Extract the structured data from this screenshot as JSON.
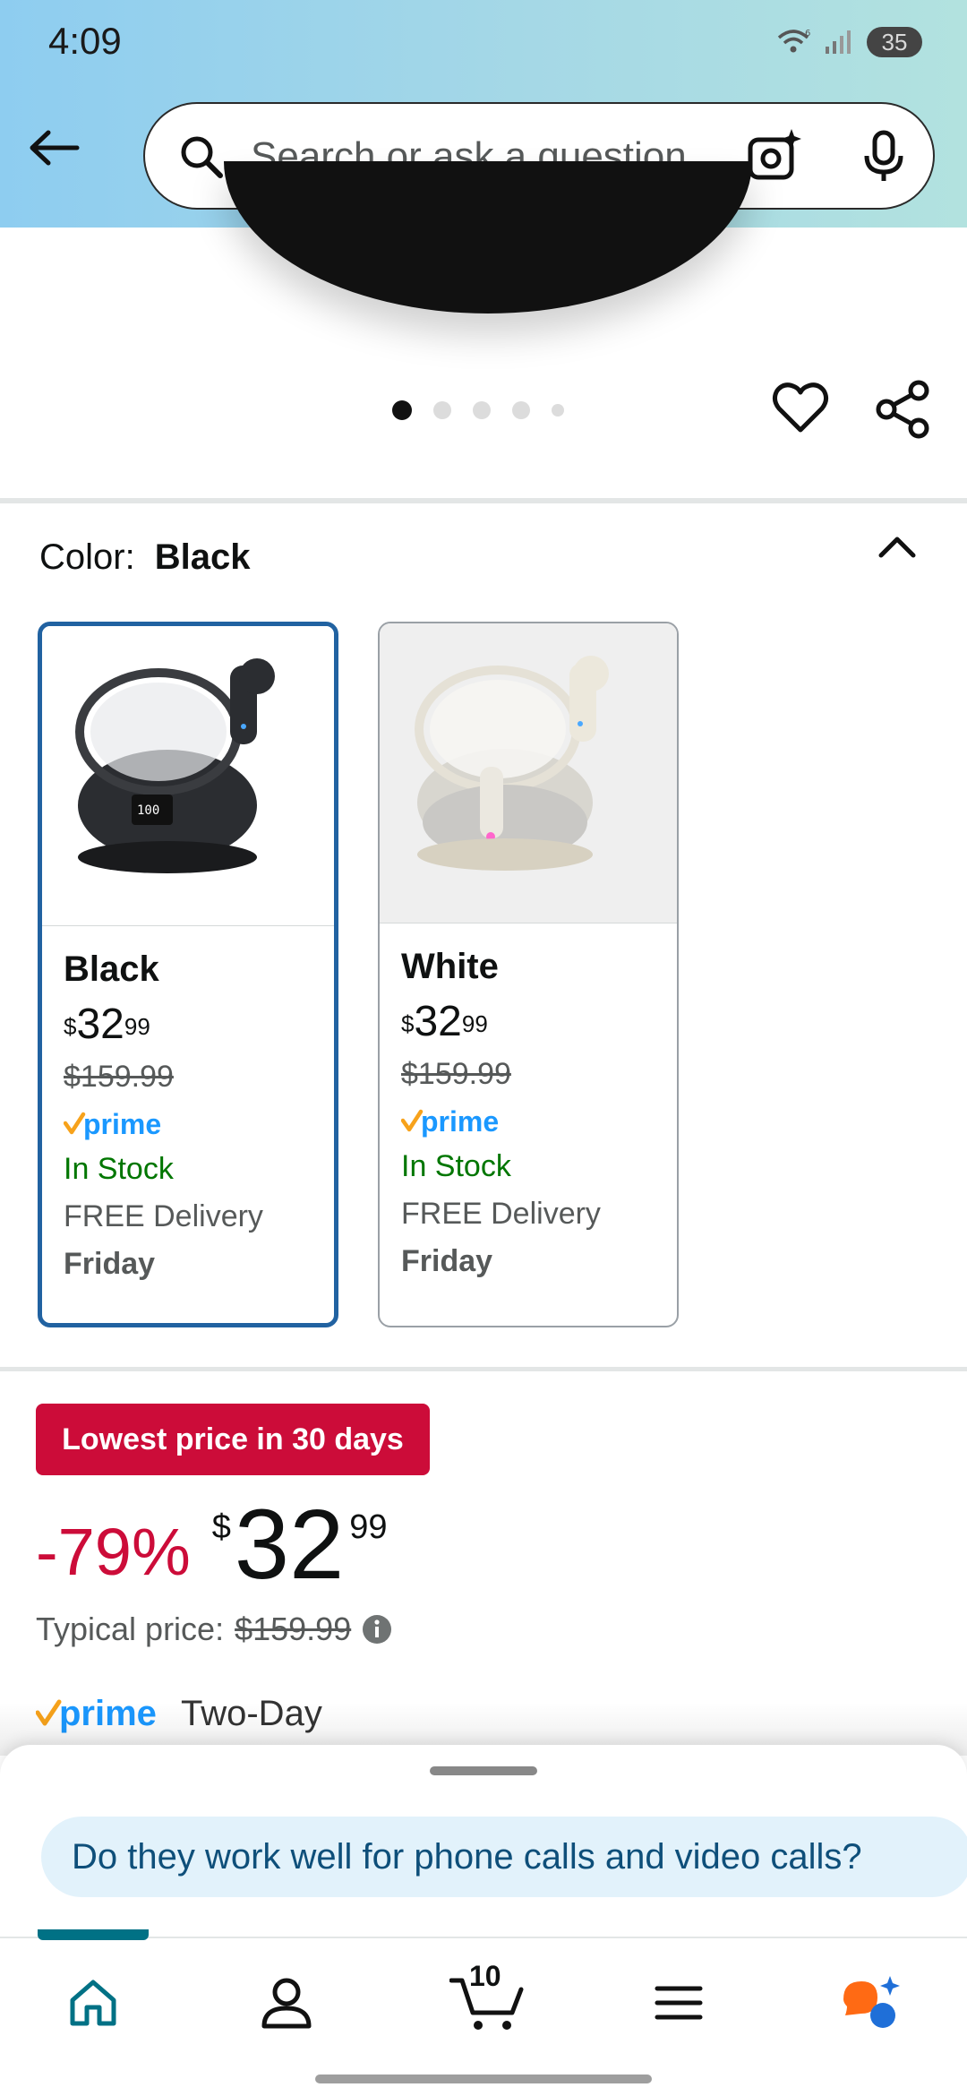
{
  "status_bar": {
    "time": "4:09",
    "battery": "35"
  },
  "search": {
    "placeholder": "Search or ask a question"
  },
  "color_selector": {
    "label": "Color:",
    "selected": "Black",
    "options": [
      {
        "name": "Black",
        "price_whole": "32",
        "price_fraction": "99",
        "currency": "$",
        "list_price": "$159.99",
        "prime": "prime",
        "stock": "In Stock",
        "delivery": "FREE Delivery",
        "delivery_day": "Friday"
      },
      {
        "name": "White",
        "price_whole": "32",
        "price_fraction": "99",
        "currency": "$",
        "list_price": "$159.99",
        "prime": "prime",
        "stock": "In Stock",
        "delivery": "FREE Delivery",
        "delivery_day": "Friday"
      }
    ]
  },
  "deal": {
    "badge": "Lowest price in 30 days",
    "discount": "-79%",
    "currency": "$",
    "price_whole": "32",
    "price_fraction": "99",
    "typical_label": "Typical price:",
    "typical_price": "$159.99"
  },
  "prime_delivery": {
    "logo": "prime",
    "label": "Two-Day"
  },
  "assistant": {
    "suggestion": "Do they work well for phone calls and video calls?"
  },
  "bottom_nav": {
    "cart_count": "10"
  },
  "colors": {
    "accent": "#2162a1",
    "deal_red": "#cc0c39",
    "stock_green": "#007600",
    "prime_blue": "#1a98ff"
  }
}
